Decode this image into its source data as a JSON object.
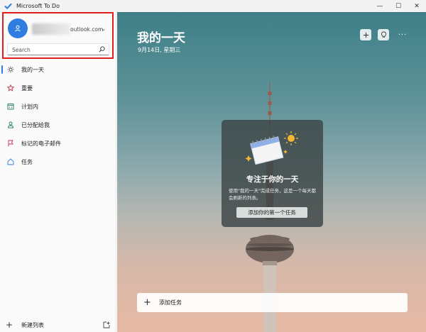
{
  "app": {
    "title": "Microsoft To Do"
  },
  "window": {
    "minimize": "—",
    "maximize": "☐",
    "close": "✕"
  },
  "account": {
    "email_suffix": "outlook.com",
    "chevron": "⌄"
  },
  "search": {
    "placeholder": "Search"
  },
  "nav": [
    {
      "label": "我的一天",
      "icon": "sun-icon",
      "active": true
    },
    {
      "label": "重要",
      "icon": "star-icon"
    },
    {
      "label": "计划内",
      "icon": "calendar-icon"
    },
    {
      "label": "已分配给我",
      "icon": "person-icon"
    },
    {
      "label": "标记的电子邮件",
      "icon": "flag-icon"
    },
    {
      "label": "任务",
      "icon": "home-icon"
    }
  ],
  "footer": {
    "new_list": "新建列表",
    "plus": "+"
  },
  "main": {
    "title": "我的一天",
    "date": "9月14日, 星期三",
    "more": "···"
  },
  "focus": {
    "title": "专注于你的一天",
    "description": "使用\"我的一天\"完成任务，这是一个每天都会刷新的列表。",
    "button": "添加你的第一个任务"
  },
  "add_task": {
    "plus": "+",
    "label": "添加任务"
  },
  "colors": {
    "accent": "#2f7de1",
    "highlight_border": "#e02020"
  }
}
